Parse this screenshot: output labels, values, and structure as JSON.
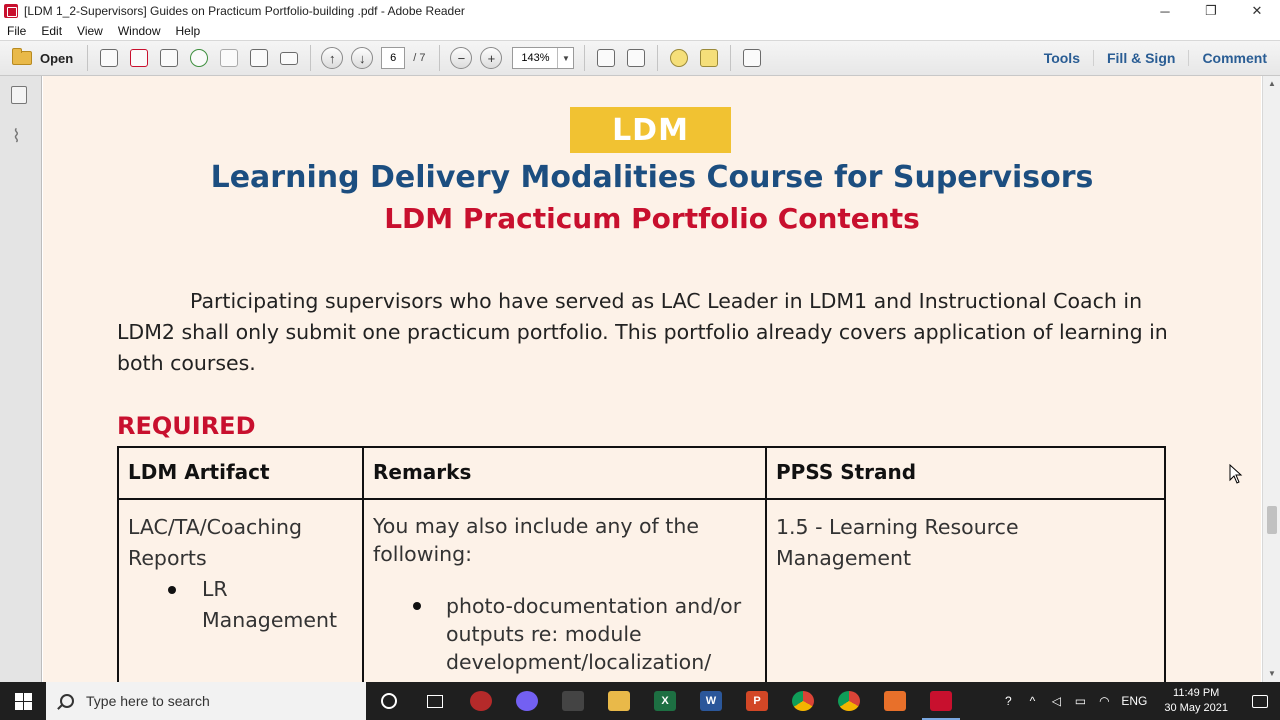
{
  "window": {
    "title": "[LDM 1_2-Supervisors] Guides on Practicum Portfolio-building .pdf - Adobe Reader",
    "minimize": "─",
    "maximize": "❐",
    "close": "✕"
  },
  "menu": [
    "File",
    "Edit",
    "View",
    "Window",
    "Help"
  ],
  "toolbar": {
    "open_label": "Open",
    "page_current": "6",
    "page_total": "/ 7",
    "zoom": "143%",
    "right": [
      "Tools",
      "Fill & Sign",
      "Comment"
    ]
  },
  "document": {
    "badge": "LDM",
    "title": "Learning Delivery Modalities Course for Supervisors",
    "subtitle": "LDM Practicum Portfolio Contents",
    "intro": "Participating supervisors who have served as LAC Leader in LDM1 and Instructional Coach in LDM2 shall only submit one practicum portfolio. This portfolio already covers application of learning in both courses.",
    "required_label": "REQUIRED",
    "table": {
      "headers": [
        "LDM Artifact",
        "Remarks",
        "PPSS  Strand"
      ],
      "row1": {
        "artifact": "LAC/TA/Coaching Reports",
        "artifact_bullet": "LR Management",
        "remarks_intro": "You may also include any of the following:",
        "remarks_bullet": "photo-documentation and/or outputs re: module development/localization/",
        "strand": "1.5 - Learning Resource Management"
      }
    }
  },
  "taskbar": {
    "search_placeholder": "Type here to search",
    "language": "ENG",
    "time": "11:49 PM",
    "date": "30 May 2021"
  },
  "colors": {
    "doc_background": "#fdf2e8",
    "badge": "#f1c232",
    "title_blue": "#1c4e80",
    "accent_red": "#c8102e",
    "toolbar_link": "#2a5d94"
  }
}
